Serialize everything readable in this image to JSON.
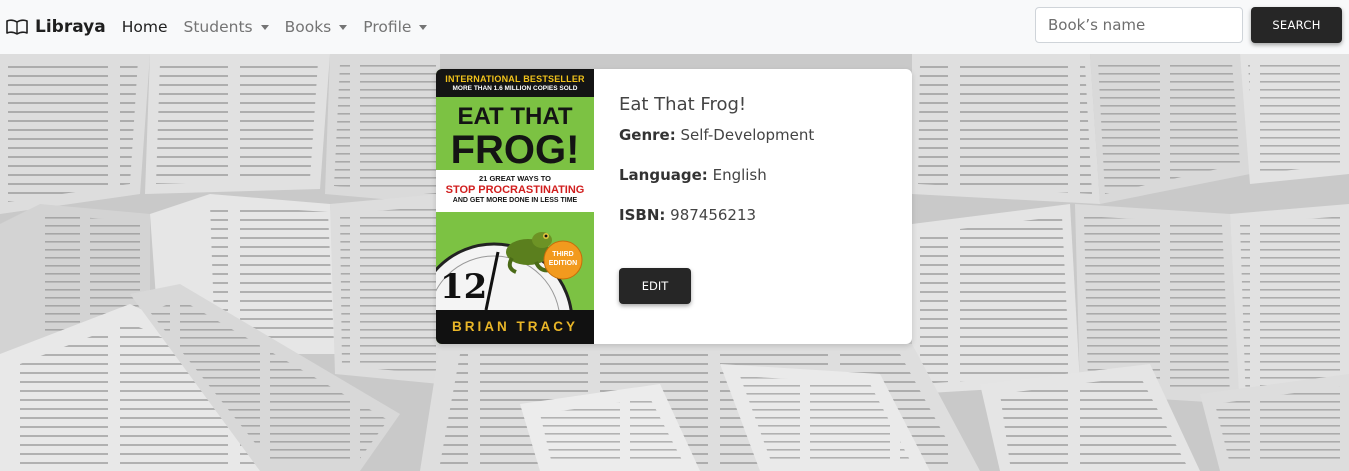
{
  "brand": {
    "name": "Libraya",
    "icon": "open-book-icon"
  },
  "nav": {
    "items": [
      {
        "label": "Home",
        "active": true,
        "dropdown": false
      },
      {
        "label": "Students",
        "active": false,
        "dropdown": true
      },
      {
        "label": "Books",
        "active": false,
        "dropdown": true
      },
      {
        "label": "Profile",
        "active": false,
        "dropdown": true
      }
    ]
  },
  "search": {
    "placeholder": "Book’s name",
    "value": "",
    "button_label": "SEARCH"
  },
  "book": {
    "title": "Eat That Frog!",
    "genre_label": "Genre:",
    "genre": "Self-Development",
    "language_label": "Language:",
    "language": "English",
    "isbn_label": "ISBN:",
    "isbn": "987456213",
    "edit_label": "EDIT",
    "cover": {
      "banner_line1": "INTERNATIONAL BESTSELLER",
      "banner_line2": "MORE THAN 1.6 MILLION COPIES SOLD",
      "title_line1": "EAT THAT",
      "title_line2": "FROG!",
      "subtitle_line1": "21 GREAT WAYS TO",
      "subtitle_line2": "STOP PROCRASTINATING",
      "subtitle_line3": "AND GET MORE DONE IN LESS TIME",
      "badge_line1": "THIRD",
      "badge_line2": "EDITION",
      "clock_numbers": "12",
      "author": "BRIAN TRACY"
    }
  },
  "colors": {
    "accent": "#262626",
    "navbar": "#f8f9fa",
    "cover_green": "#7cc243"
  }
}
